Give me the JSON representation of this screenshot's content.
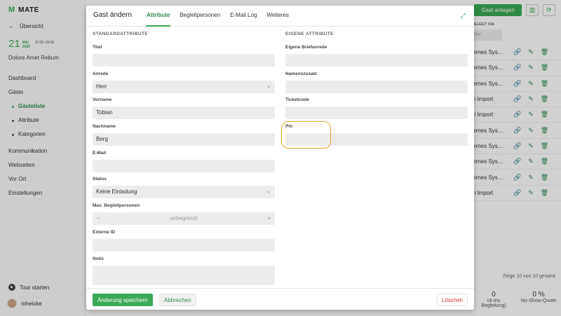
{
  "app": {
    "name": "MATE",
    "logo_glyph": "M"
  },
  "sidebar": {
    "back_label": "Übersicht",
    "event_day": "21",
    "event_month": "MAI",
    "event_year": "2020",
    "event_time": "11:00–15:00",
    "event_name": "Dolore Amet Rebum",
    "nav": [
      {
        "label": "Dashboard"
      },
      {
        "label": "Gäste"
      },
      {
        "label": "Gästeliste"
      },
      {
        "label": "Attribute"
      },
      {
        "label": "Kategorien"
      },
      {
        "label": "Kommunikation"
      },
      {
        "label": "Webseiten"
      },
      {
        "label": "Vor Ort"
      },
      {
        "label": "Einstellungen"
      }
    ],
    "tour_label": "Tour starten",
    "user_name": "mheicke"
  },
  "topbar": {
    "add_guest_label": "Gast anlegen"
  },
  "table": {
    "col_header": "ELEGT VIA",
    "filter_placeholder": "lter",
    "rows": [
      {
        "source": "ternes Sys…"
      },
      {
        "source": "ternes Sys…"
      },
      {
        "source": "ternes Sys…"
      },
      {
        "source": "ei Import"
      },
      {
        "source": "ei Import"
      },
      {
        "source": "ternes Sys…"
      },
      {
        "source": "ternes Sys…"
      },
      {
        "source": "ternes Sys…"
      },
      {
        "source": "ternes Sys…"
      },
      {
        "source": "ei Import"
      }
    ],
    "count_label": "Zeige 10 von 10 gesamt"
  },
  "stats": [
    {
      "value": "0",
      "label": "ck-ins"
    },
    {
      "value": "0 %",
      "label": "No-Show-Quote"
    }
  ],
  "stats_sub": "Begleitung)",
  "modal": {
    "title": "Gast ändern",
    "tabs": [
      {
        "label": "Attribute"
      },
      {
        "label": "Begleitpersonen"
      },
      {
        "label": "E-Mail Log"
      },
      {
        "label": "Weiteres"
      }
    ],
    "left_section": "STANDARDATTRIBUTE",
    "right_section": "EIGENE ATTRIBUTE",
    "fields_left": [
      {
        "label": "Titel",
        "value": ""
      },
      {
        "label": "Anrede",
        "value": "Herr"
      },
      {
        "label": "Vorname",
        "value": "Tobian"
      },
      {
        "label": "Nachname",
        "value": "Berg"
      },
      {
        "label": "E-Mail",
        "value": ""
      },
      {
        "label": "Status",
        "value": "Keine Einladung"
      },
      {
        "label": "Max. Begleitpersonen",
        "value": "unbegrenzt"
      },
      {
        "label": "Externe ID",
        "value": ""
      },
      {
        "label": "Notiz",
        "value": ""
      }
    ],
    "fields_right": [
      {
        "label": "Eigene Briefanrede",
        "value": ""
      },
      {
        "label": "Namenszusatz",
        "value": ""
      },
      {
        "label": "Ticketcode",
        "value": ""
      },
      {
        "label": "Pin",
        "value": ""
      }
    ],
    "save_label": "Änderung speichern",
    "cancel_label": "Abbrechen",
    "delete_label": "Löschen"
  },
  "colors": {
    "accent": "#3aa856",
    "highlight": "#e6a22a",
    "danger": "#dd3333"
  }
}
